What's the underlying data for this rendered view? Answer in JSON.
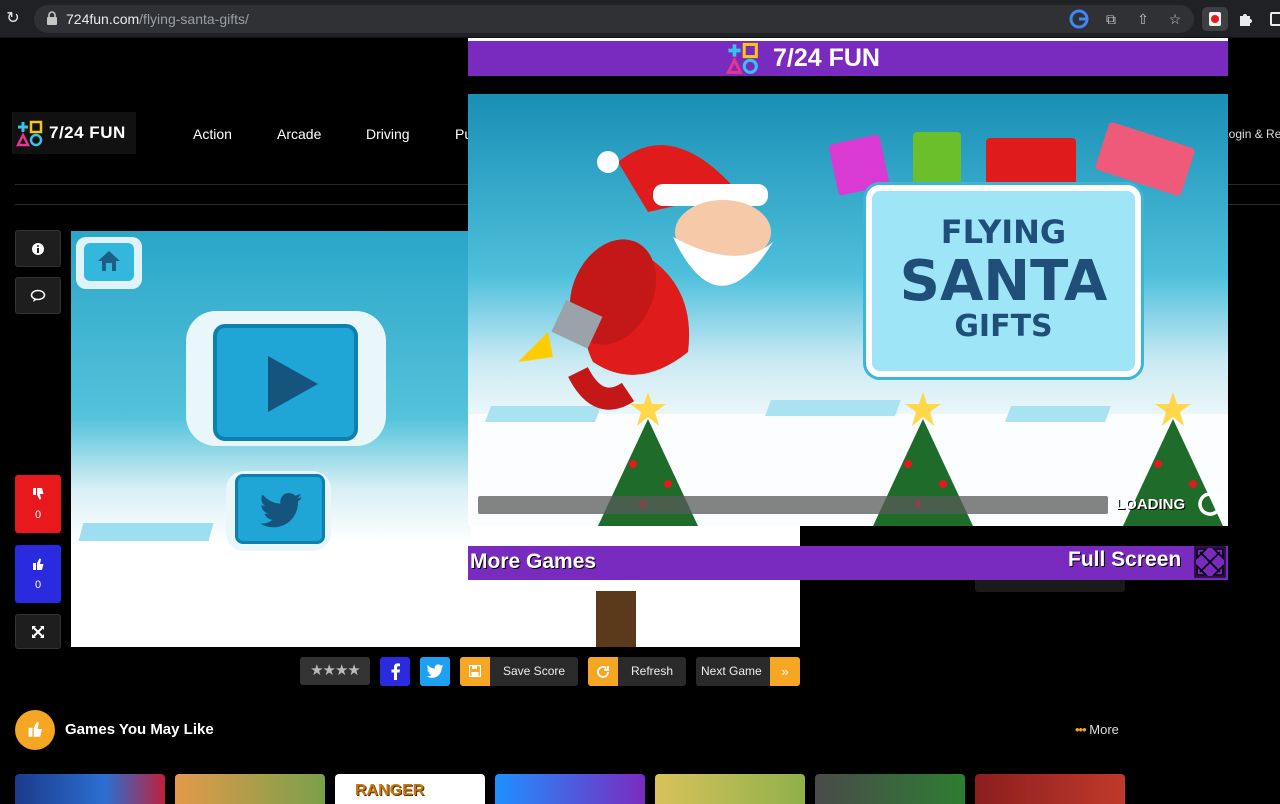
{
  "browser": {
    "url_host": "724fun.com",
    "url_path": "/flying-santa-gifts/"
  },
  "site": {
    "logo_text": "7/24 FUN",
    "nav": [
      "Action",
      "Arcade",
      "Driving",
      "Pu"
    ],
    "login_label": "Login & Reg"
  },
  "sidebar": {
    "dislike_count": "0",
    "like_count": "0"
  },
  "toolbar": {
    "rating_stars": "★★★★",
    "save_score_label": "Save Score",
    "refresh_label": "Refresh",
    "next_game_label": "Next Game",
    "next_arrow": "»"
  },
  "games_you_may_like": {
    "title": "Games You May Like",
    "more_label": "More",
    "thumbnail_captions": [
      "RANGER"
    ]
  },
  "popup": {
    "title": "7/24 FUN",
    "game_title_line1": "FLYING",
    "game_title_line2": "SANTA",
    "game_title_line3": "GIFTS",
    "loading_text": "LOADING",
    "more_games_label": "More Games",
    "full_screen_label": "Full Screen"
  },
  "colors": {
    "purple": "#7a2bbf",
    "dislike_red": "#e8191c",
    "like_blue": "#2a2adf",
    "orange": "#f5a623",
    "facebook": "#2a2adf",
    "twitter": "#1ea1f2"
  }
}
